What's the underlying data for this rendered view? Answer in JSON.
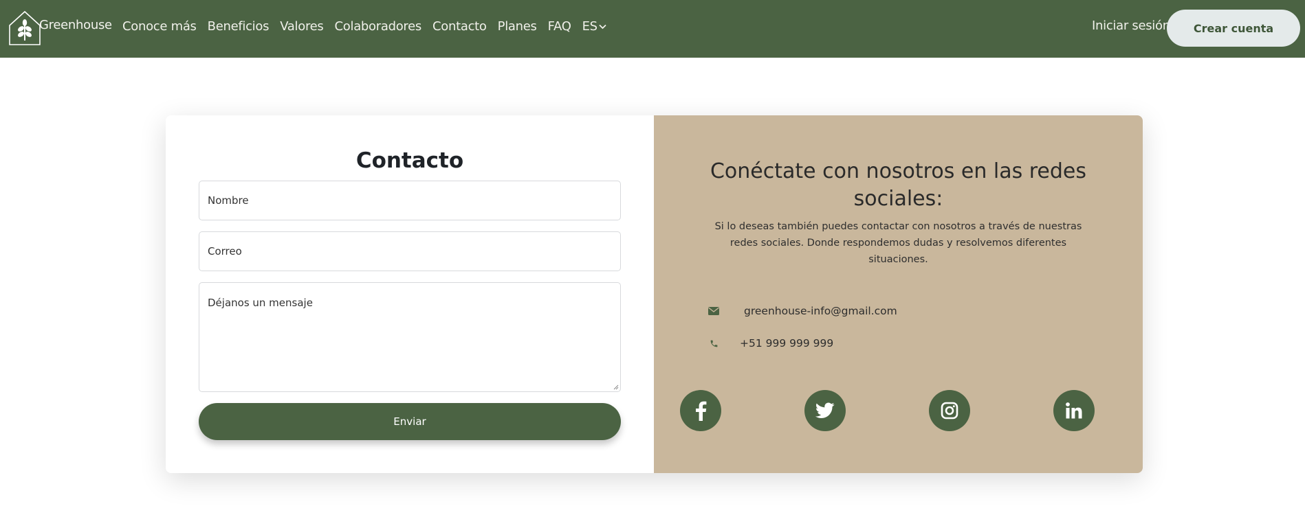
{
  "navbar": {
    "brand": "Greenhouse",
    "links": [
      "Conoce más",
      "Beneficios",
      "Valores",
      "Colaboradores",
      "Contacto",
      "Planes",
      "FAQ"
    ],
    "language": "ES",
    "login_label": "Iniciar sesión",
    "signup_label": "Crear cuenta"
  },
  "contact_form": {
    "title": "Contacto",
    "name_placeholder": "Nombre",
    "email_placeholder": "Correo",
    "message_placeholder": "Déjanos un mensaje",
    "submit_label": "Enviar"
  },
  "social_panel": {
    "title": "Conéctate con nosotros en las redes sociales:",
    "description": "Si lo deseas también puedes contactar con nosotros a través de nuestras redes sociales. Donde respondemos dudas y resolvemos diferentes situaciones.",
    "email": "greenhouse-info@gmail.com",
    "phone": "+51 999 999 999",
    "networks": [
      "facebook-icon",
      "twitter-icon",
      "instagram-icon",
      "linkedin-icon"
    ]
  },
  "colors": {
    "primary_green": "#4b6343",
    "panel_tan": "#c9b79c",
    "signup_bg": "#e4eaea"
  }
}
